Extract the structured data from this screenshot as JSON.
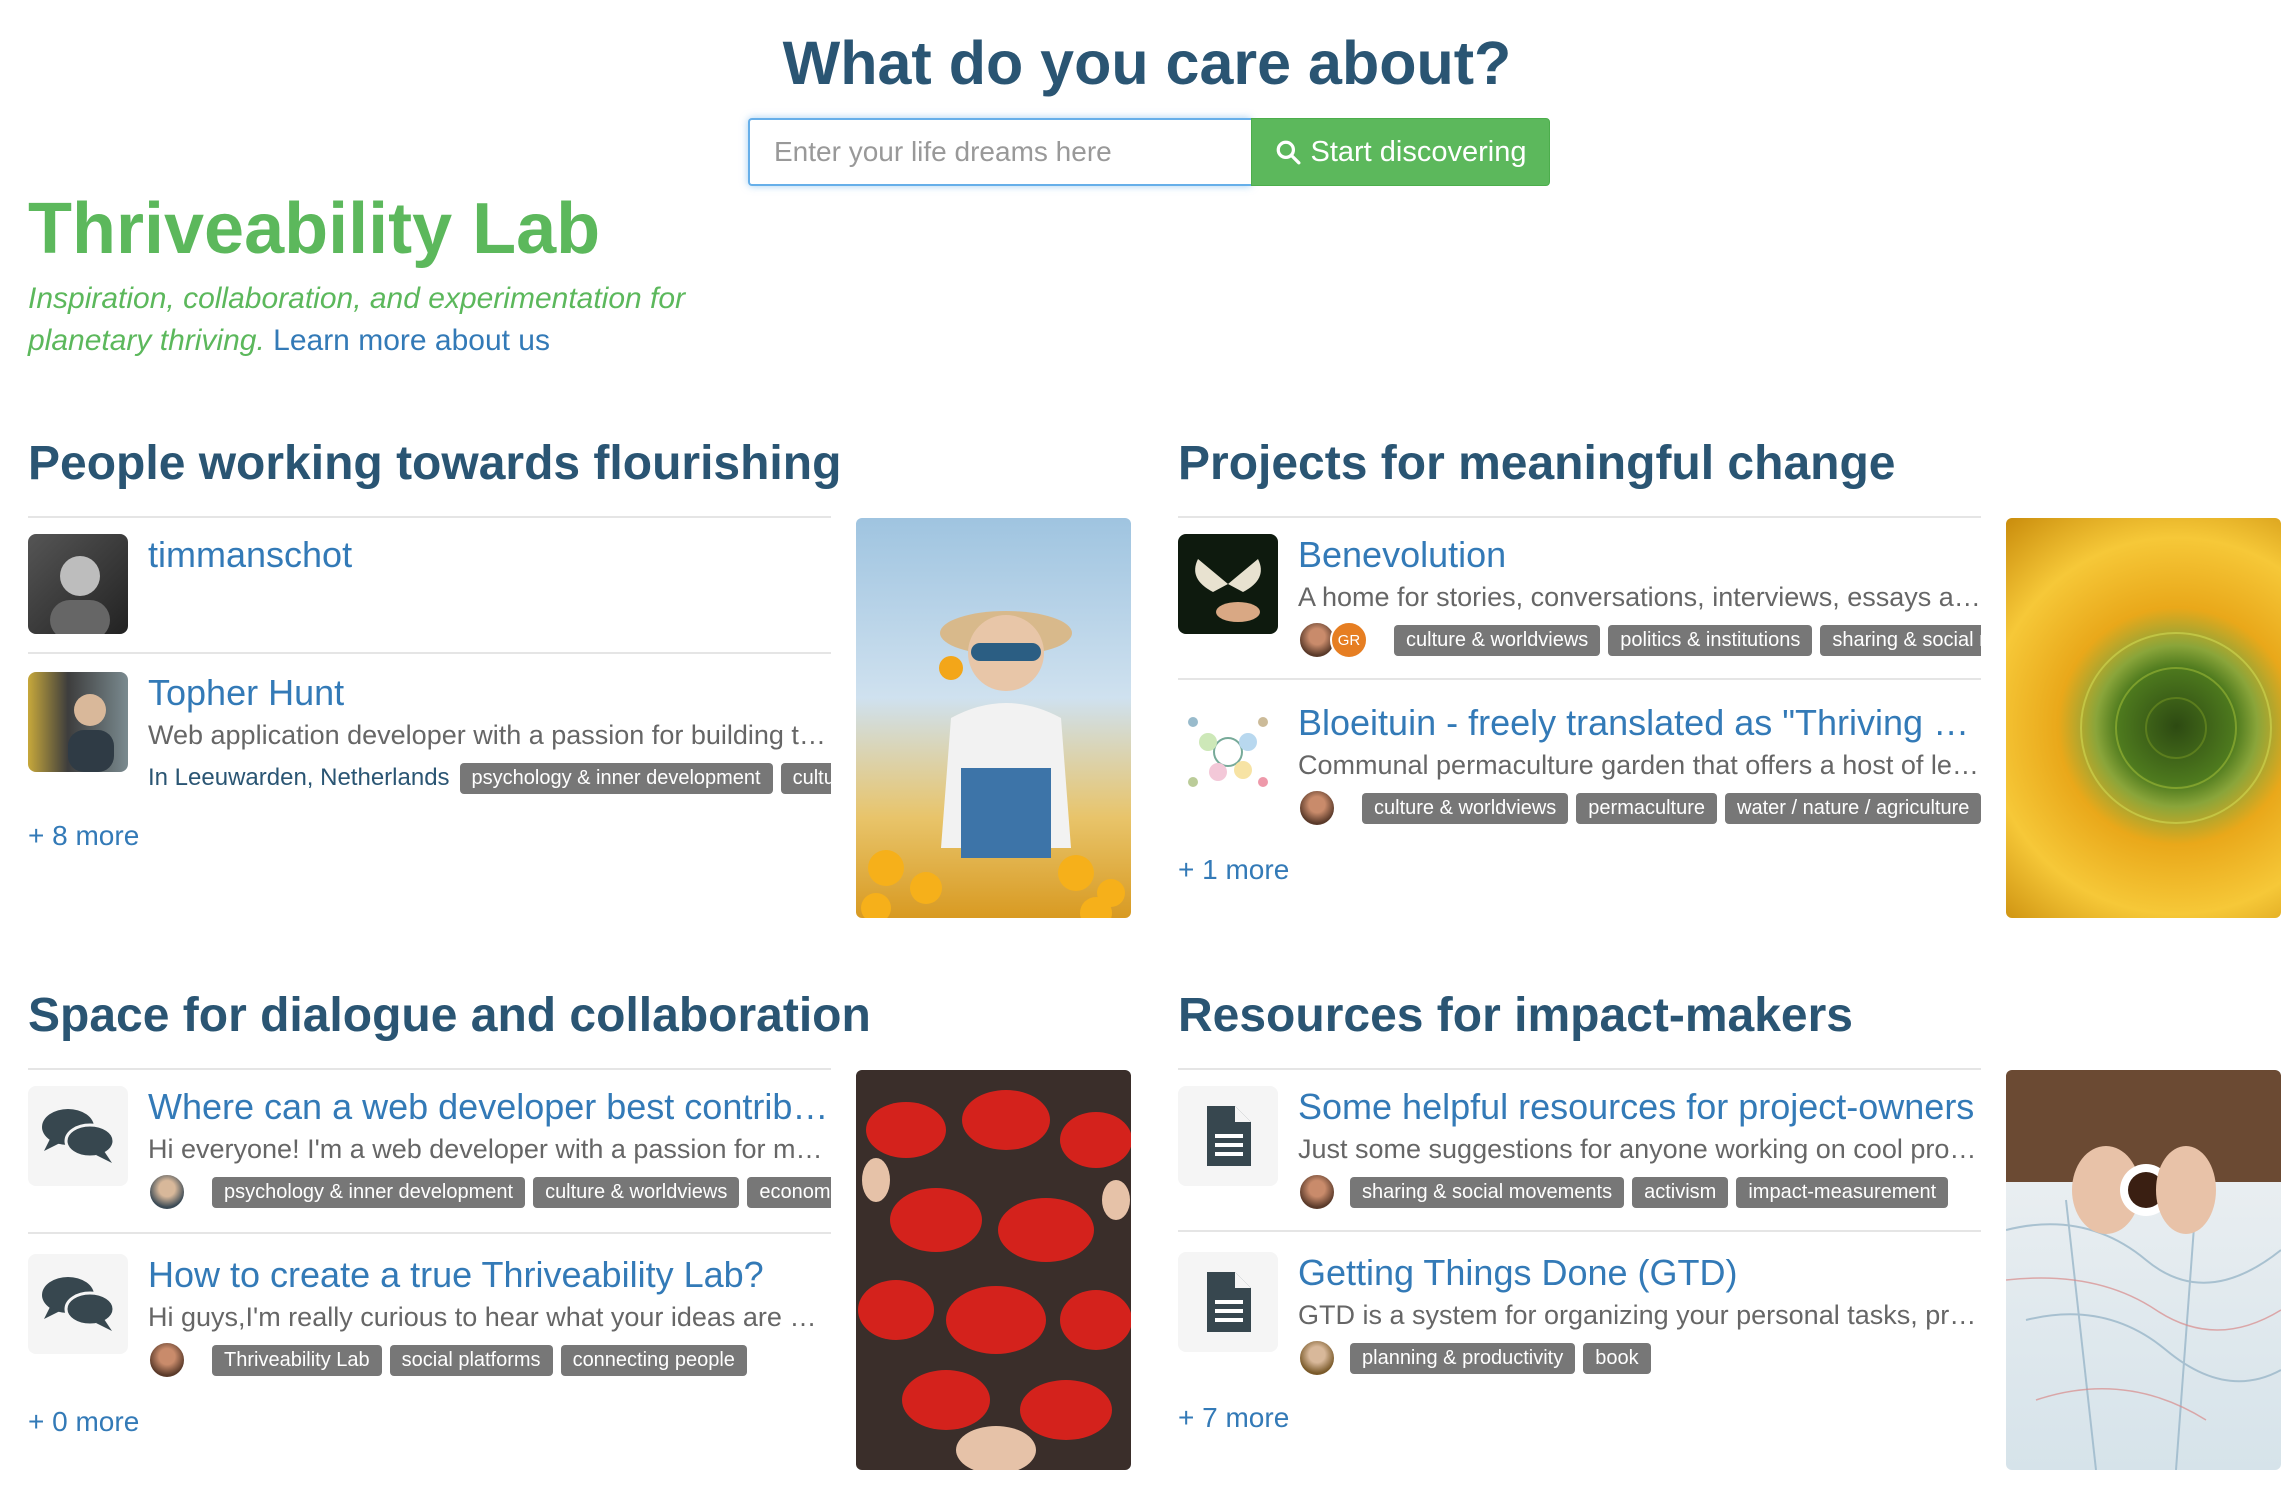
{
  "hero": {
    "title": "What do you care about?",
    "search_placeholder": "Enter your life dreams here",
    "search_button": "Start discovering",
    "search_icon": "search-icon"
  },
  "brand": {
    "title": "Thriveability Lab",
    "tagline": "Inspiration, collaboration, and experimentation for planetary thriving.",
    "learn_more": "Learn more about us"
  },
  "colors": {
    "heading": "#2a5573",
    "brand_green": "#5cb85c",
    "link": "#337ab7",
    "tag_bg": "#777777"
  },
  "people": {
    "heading": "People working towards flourishing",
    "items": [
      {
        "name": "timmanschot"
      },
      {
        "name": "Topher Hunt",
        "desc": "Web application developer with a passion for building tools for change",
        "location": "In Leeuwarden, Netherlands",
        "tags": [
          "psychology & inner development",
          "culture & worldviews"
        ]
      }
    ],
    "more": "+ 8 more"
  },
  "projects": {
    "heading": "Projects for meaningful change",
    "items": [
      {
        "title": "Benevolution",
        "desc": "A home for stories, conversations, interviews, essays and more",
        "avatar_initials": "GR",
        "tags": [
          "culture & worldviews",
          "politics & institutions",
          "sharing & social movements"
        ]
      },
      {
        "title": "Bloeituin - freely translated as \"Thriving Garden\"",
        "desc": "Communal permaculture garden that offers a host of learning opportunities",
        "tags": [
          "culture & worldviews",
          "permaculture",
          "water / nature / agriculture"
        ]
      }
    ],
    "more": "+ 1 more"
  },
  "dialogue": {
    "heading": "Space for dialogue and collaboration",
    "items": [
      {
        "title": "Where can a web developer best contribute?",
        "desc": "Hi everyone! I'm a web developer with a passion for making things",
        "tags": [
          "psychology & inner development",
          "culture & worldviews",
          "economics"
        ]
      },
      {
        "title": "How to create a true Thriveability Lab?",
        "desc": "Hi guys,I'm really curious to hear what your ideas are about this",
        "tags": [
          "Thriveability Lab",
          "social platforms",
          "connecting people"
        ]
      }
    ],
    "more": "+ 0 more"
  },
  "resources": {
    "heading": "Resources for impact-makers",
    "items": [
      {
        "title": "Some helpful resources for project-owners",
        "desc": "Just some suggestions for anyone working on cool projects",
        "tags": [
          "sharing & social movements",
          "activism",
          "impact-measurement"
        ]
      },
      {
        "title": "Getting Things Done (GTD)",
        "desc": "GTD is a system for organizing your personal tasks, projects and goals",
        "tags": [
          "planning & productivity",
          "book"
        ]
      }
    ],
    "more": "+ 7 more"
  }
}
